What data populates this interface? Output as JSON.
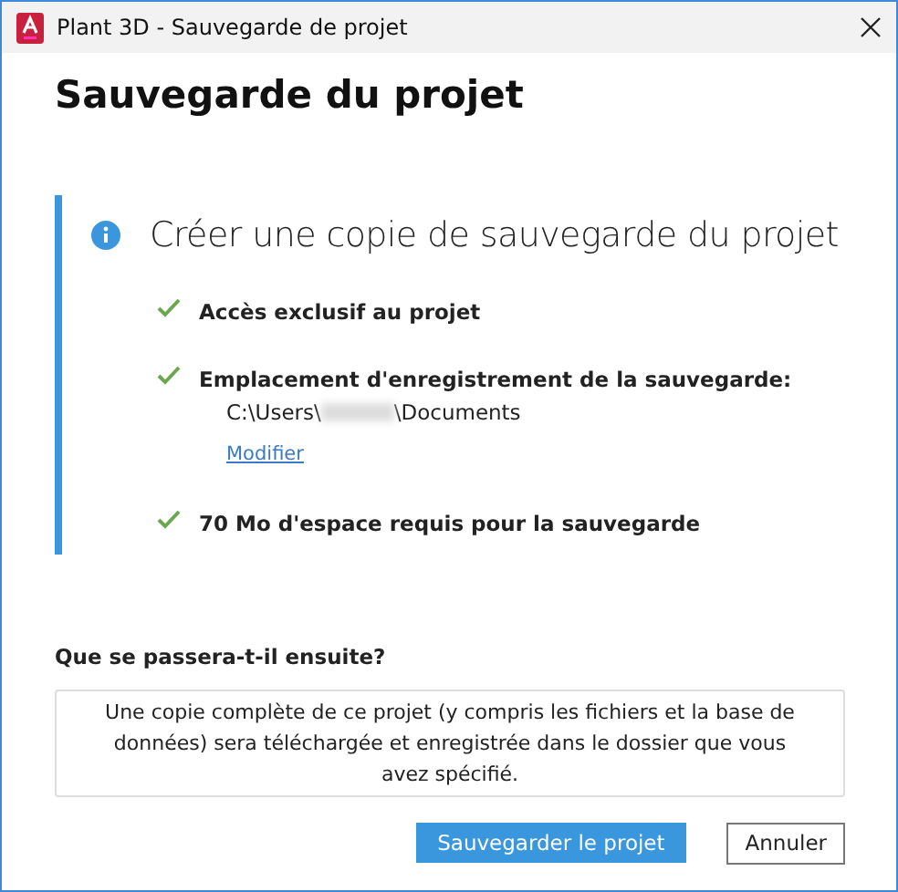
{
  "window": {
    "title": "Plant 3D - Sauvegarde de projet"
  },
  "heading": "Sauvegarde du projet",
  "info": {
    "title": "Créer une copie de sauvegarde du projet",
    "items": [
      {
        "kind": "plain",
        "text": "Accès exclusif au projet"
      },
      {
        "kind": "location",
        "text": "Emplacement d'enregistrement de la sauvegarde:",
        "path_start": "C:\\Users\\",
        "path_end": "\\Documents",
        "link": "Modifier"
      },
      {
        "kind": "plain",
        "text": "70 Mo d'espace requis pour la sauvegarde"
      }
    ]
  },
  "question": "Que se passera-t-il ensuite?",
  "answer": "Une copie complète de ce projet (y compris les fichiers et la base de données) sera téléchargée et enregistrée dans le dossier que vous avez spécifié.",
  "buttons": [
    {
      "kind": "primary",
      "label": "Sauvegarder le projet"
    },
    {
      "kind": "secondary",
      "label": "Annuler"
    }
  ]
}
